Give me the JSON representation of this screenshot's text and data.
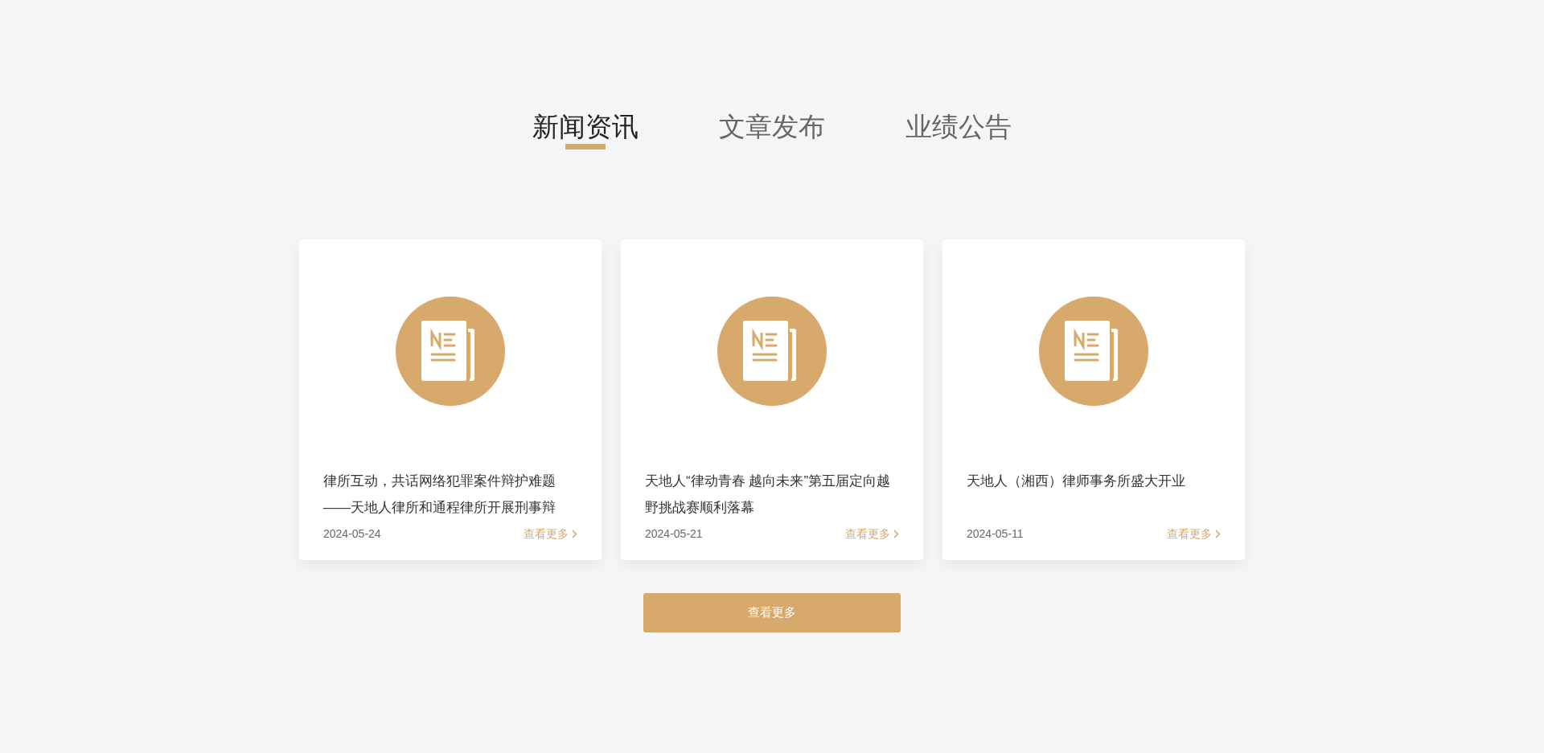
{
  "tabs": [
    {
      "label": "新闻资讯",
      "selected": true
    },
    {
      "label": "文章发布",
      "selected": false
    },
    {
      "label": "业绩公告",
      "selected": false
    }
  ],
  "cards": [
    {
      "title": "律所互动，共话网络犯罪案件辩护难题——天地人律所和通程律所开展刑事辩",
      "date": "2024-05-24",
      "link": "查看更多"
    },
    {
      "title": "天地人“律动青春 越向未来”第五届定向越野挑战赛顺利落幕",
      "date": "2024-05-21",
      "link": "查看更多"
    },
    {
      "title": "天地人（湘西）律师事务所盛大开业",
      "date": "2024-05-11",
      "link": "查看更多"
    }
  ],
  "more_button": "查看更多"
}
